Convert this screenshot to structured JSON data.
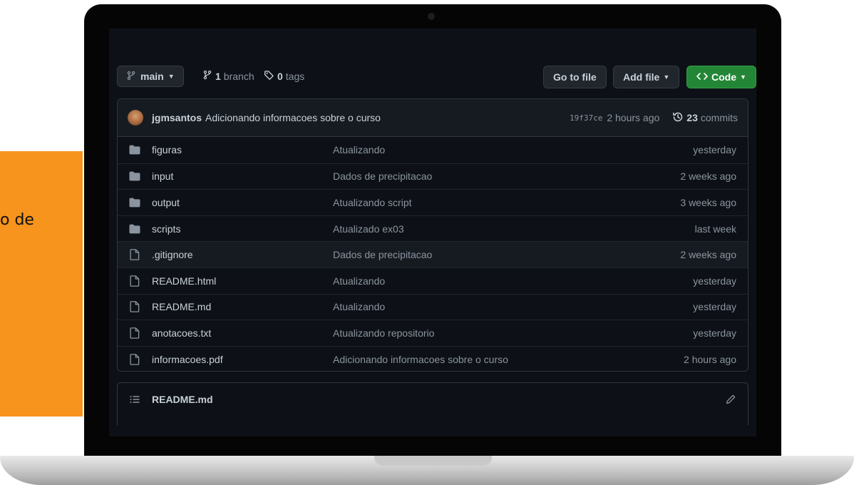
{
  "side_card": {
    "partial_text": "o de",
    "color": "#f7941d"
  },
  "repo": {
    "branch": {
      "name": "main"
    },
    "branches": {
      "count": "1",
      "label": "branch"
    },
    "tags": {
      "count": "0",
      "label": "tags"
    },
    "buttons": {
      "go_to_file": "Go to file",
      "add_file": "Add file",
      "code": "Code"
    },
    "latest_commit": {
      "author": "jgmsantos",
      "message": "Adicionando informacoes sobre o curso",
      "sha": "19f37ce",
      "age": "2 hours ago",
      "commit_count": "23",
      "commit_label": "commits"
    },
    "files": [
      {
        "name": "figuras",
        "type": "folder",
        "message": "Atualizando",
        "age": "yesterday"
      },
      {
        "name": "input",
        "type": "folder",
        "message": "Dados de precipitacao",
        "age": "2 weeks ago"
      },
      {
        "name": "output",
        "type": "folder",
        "message": "Atualizando script",
        "age": "3 weeks ago"
      },
      {
        "name": "scripts",
        "type": "folder",
        "message": "Atualizado ex03",
        "age": "last week"
      },
      {
        "name": ".gitignore",
        "type": "file",
        "message": "Dados de precipitacao",
        "age": "2 weeks ago"
      },
      {
        "name": "README.html",
        "type": "file",
        "message": "Atualizando",
        "age": "yesterday"
      },
      {
        "name": "README.md",
        "type": "file",
        "message": "Atualizando",
        "age": "yesterday"
      },
      {
        "name": "anotacoes.txt",
        "type": "file",
        "message": "Atualizando repositorio",
        "age": "yesterday"
      },
      {
        "name": "informacoes.pdf",
        "type": "file",
        "message": "Adicionando informacoes sobre o curso",
        "age": "2 hours ago"
      }
    ],
    "readme": {
      "title": "README.md"
    }
  },
  "colors": {
    "background": "#0d1117",
    "border": "#30363d",
    "text": "#c9d1d9",
    "muted": "#8b949e",
    "code_button": "#238636",
    "folder_icon": "#8b949e"
  }
}
